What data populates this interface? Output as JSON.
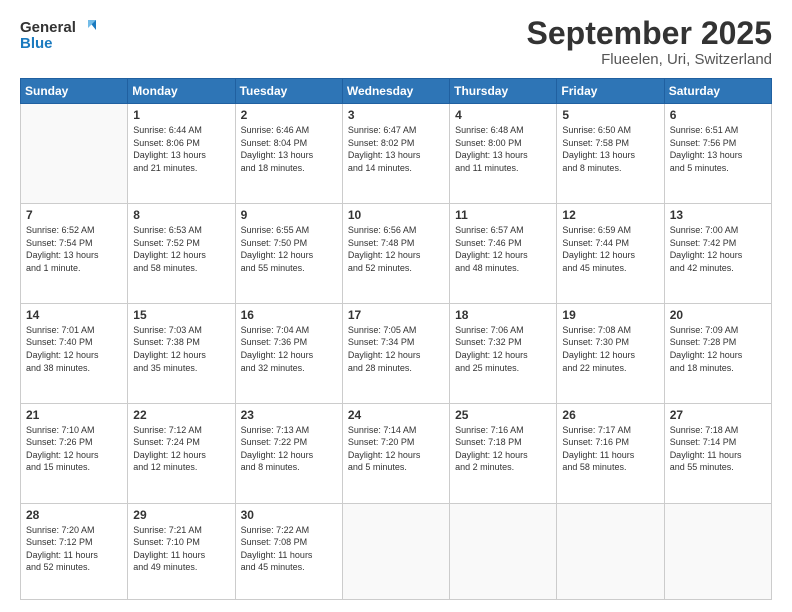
{
  "header": {
    "logo_line1": "General",
    "logo_line2": "Blue",
    "title": "September 2025",
    "subtitle": "Flueelen, Uri, Switzerland"
  },
  "calendar": {
    "days_of_week": [
      "Sunday",
      "Monday",
      "Tuesday",
      "Wednesday",
      "Thursday",
      "Friday",
      "Saturday"
    ],
    "weeks": [
      [
        {
          "day": "",
          "info": ""
        },
        {
          "day": "1",
          "info": "Sunrise: 6:44 AM\nSunset: 8:06 PM\nDaylight: 13 hours\nand 21 minutes."
        },
        {
          "day": "2",
          "info": "Sunrise: 6:46 AM\nSunset: 8:04 PM\nDaylight: 13 hours\nand 18 minutes."
        },
        {
          "day": "3",
          "info": "Sunrise: 6:47 AM\nSunset: 8:02 PM\nDaylight: 13 hours\nand 14 minutes."
        },
        {
          "day": "4",
          "info": "Sunrise: 6:48 AM\nSunset: 8:00 PM\nDaylight: 13 hours\nand 11 minutes."
        },
        {
          "day": "5",
          "info": "Sunrise: 6:50 AM\nSunset: 7:58 PM\nDaylight: 13 hours\nand 8 minutes."
        },
        {
          "day": "6",
          "info": "Sunrise: 6:51 AM\nSunset: 7:56 PM\nDaylight: 13 hours\nand 5 minutes."
        }
      ],
      [
        {
          "day": "7",
          "info": "Sunrise: 6:52 AM\nSunset: 7:54 PM\nDaylight: 13 hours\nand 1 minute."
        },
        {
          "day": "8",
          "info": "Sunrise: 6:53 AM\nSunset: 7:52 PM\nDaylight: 12 hours\nand 58 minutes."
        },
        {
          "day": "9",
          "info": "Sunrise: 6:55 AM\nSunset: 7:50 PM\nDaylight: 12 hours\nand 55 minutes."
        },
        {
          "day": "10",
          "info": "Sunrise: 6:56 AM\nSunset: 7:48 PM\nDaylight: 12 hours\nand 52 minutes."
        },
        {
          "day": "11",
          "info": "Sunrise: 6:57 AM\nSunset: 7:46 PM\nDaylight: 12 hours\nand 48 minutes."
        },
        {
          "day": "12",
          "info": "Sunrise: 6:59 AM\nSunset: 7:44 PM\nDaylight: 12 hours\nand 45 minutes."
        },
        {
          "day": "13",
          "info": "Sunrise: 7:00 AM\nSunset: 7:42 PM\nDaylight: 12 hours\nand 42 minutes."
        }
      ],
      [
        {
          "day": "14",
          "info": "Sunrise: 7:01 AM\nSunset: 7:40 PM\nDaylight: 12 hours\nand 38 minutes."
        },
        {
          "day": "15",
          "info": "Sunrise: 7:03 AM\nSunset: 7:38 PM\nDaylight: 12 hours\nand 35 minutes."
        },
        {
          "day": "16",
          "info": "Sunrise: 7:04 AM\nSunset: 7:36 PM\nDaylight: 12 hours\nand 32 minutes."
        },
        {
          "day": "17",
          "info": "Sunrise: 7:05 AM\nSunset: 7:34 PM\nDaylight: 12 hours\nand 28 minutes."
        },
        {
          "day": "18",
          "info": "Sunrise: 7:06 AM\nSunset: 7:32 PM\nDaylight: 12 hours\nand 25 minutes."
        },
        {
          "day": "19",
          "info": "Sunrise: 7:08 AM\nSunset: 7:30 PM\nDaylight: 12 hours\nand 22 minutes."
        },
        {
          "day": "20",
          "info": "Sunrise: 7:09 AM\nSunset: 7:28 PM\nDaylight: 12 hours\nand 18 minutes."
        }
      ],
      [
        {
          "day": "21",
          "info": "Sunrise: 7:10 AM\nSunset: 7:26 PM\nDaylight: 12 hours\nand 15 minutes."
        },
        {
          "day": "22",
          "info": "Sunrise: 7:12 AM\nSunset: 7:24 PM\nDaylight: 12 hours\nand 12 minutes."
        },
        {
          "day": "23",
          "info": "Sunrise: 7:13 AM\nSunset: 7:22 PM\nDaylight: 12 hours\nand 8 minutes."
        },
        {
          "day": "24",
          "info": "Sunrise: 7:14 AM\nSunset: 7:20 PM\nDaylight: 12 hours\nand 5 minutes."
        },
        {
          "day": "25",
          "info": "Sunrise: 7:16 AM\nSunset: 7:18 PM\nDaylight: 12 hours\nand 2 minutes."
        },
        {
          "day": "26",
          "info": "Sunrise: 7:17 AM\nSunset: 7:16 PM\nDaylight: 11 hours\nand 58 minutes."
        },
        {
          "day": "27",
          "info": "Sunrise: 7:18 AM\nSunset: 7:14 PM\nDaylight: 11 hours\nand 55 minutes."
        }
      ],
      [
        {
          "day": "28",
          "info": "Sunrise: 7:20 AM\nSunset: 7:12 PM\nDaylight: 11 hours\nand 52 minutes."
        },
        {
          "day": "29",
          "info": "Sunrise: 7:21 AM\nSunset: 7:10 PM\nDaylight: 11 hours\nand 49 minutes."
        },
        {
          "day": "30",
          "info": "Sunrise: 7:22 AM\nSunset: 7:08 PM\nDaylight: 11 hours\nand 45 minutes."
        },
        {
          "day": "",
          "info": ""
        },
        {
          "day": "",
          "info": ""
        },
        {
          "day": "",
          "info": ""
        },
        {
          "day": "",
          "info": ""
        }
      ]
    ]
  }
}
